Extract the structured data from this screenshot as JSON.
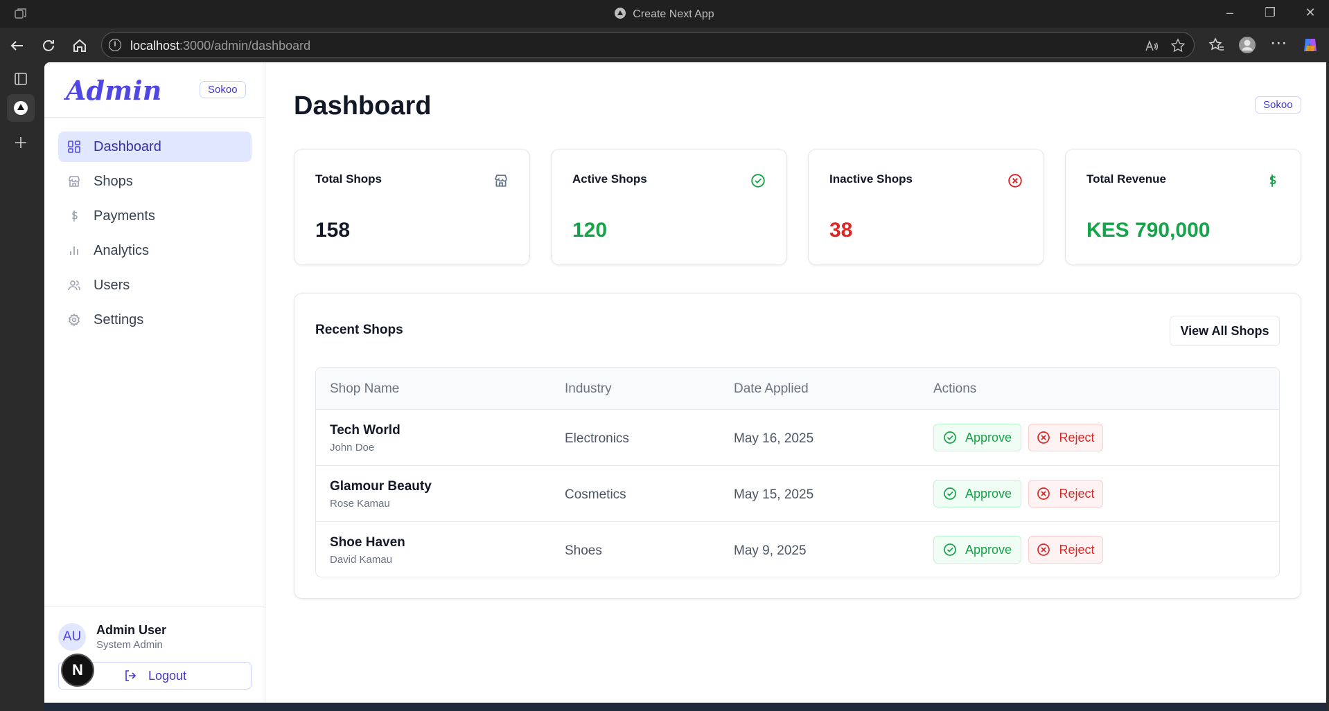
{
  "browser": {
    "window_title": "Create Next App",
    "url_host": "localhost",
    "url_path": ":3000/admin/dashboard"
  },
  "sidebar": {
    "brand": "Admin",
    "badge": "Sokoo",
    "items": [
      {
        "label": "Dashboard",
        "icon": "grid-icon",
        "active": true
      },
      {
        "label": "Shops",
        "icon": "store-icon",
        "active": false
      },
      {
        "label": "Payments",
        "icon": "dollar-icon",
        "active": false
      },
      {
        "label": "Analytics",
        "icon": "bar-chart-icon",
        "active": false
      },
      {
        "label": "Users",
        "icon": "users-icon",
        "active": false
      },
      {
        "label": "Settings",
        "icon": "gear-icon",
        "active": false
      }
    ],
    "user": {
      "initials": "AU",
      "name": "Admin User",
      "role": "System Admin"
    },
    "logout_label": "Logout",
    "next_badge": "N"
  },
  "header": {
    "title": "Dashboard",
    "badge": "Sokoo"
  },
  "stats": [
    {
      "label": "Total Shops",
      "value": "158",
      "icon": "store-icon",
      "color": "#111827"
    },
    {
      "label": "Active Shops",
      "value": "120",
      "icon": "check-circle-icon",
      "color": "#16a34a"
    },
    {
      "label": "Inactive Shops",
      "value": "38",
      "icon": "x-circle-icon",
      "color": "#dc2626"
    },
    {
      "label": "Total Revenue",
      "value": "KES 790,000",
      "icon": "dollar-icon",
      "color": "#16a34a"
    }
  ],
  "recent": {
    "title": "Recent Shops",
    "view_all_label": "View All Shops",
    "columns": [
      "Shop Name",
      "Industry",
      "Date Applied",
      "Actions"
    ],
    "rows": [
      {
        "shop": "Tech World",
        "owner": "John Doe",
        "industry": "Electronics",
        "date": "May 16, 2025"
      },
      {
        "shop": "Glamour Beauty",
        "owner": "Rose Kamau",
        "industry": "Cosmetics",
        "date": "May 15, 2025"
      },
      {
        "shop": "Shoe Haven",
        "owner": "David Kamau",
        "industry": "Shoes",
        "date": "May 9, 2025"
      }
    ],
    "approve_label": "Approve",
    "reject_label": "Reject"
  }
}
